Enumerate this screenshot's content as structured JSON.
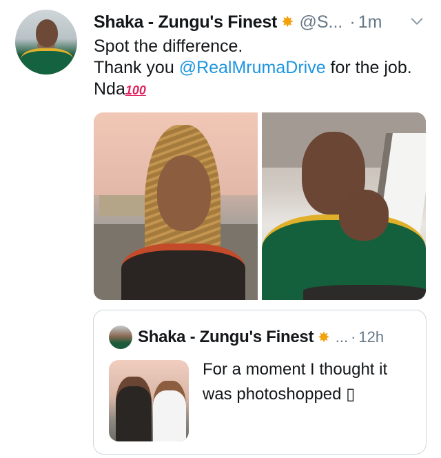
{
  "tweet": {
    "author_name": "Shaka - Zungu's Finest",
    "author_emoji": "✸",
    "handle": "@S...",
    "separator": "·",
    "time": "1m",
    "text_line1": "Spot the difference.",
    "text_line2_prefix": "Thank you ",
    "mention": "@RealMrumaDrive",
    "text_line2_suffix": " for the job.",
    "text_line3_prefix": "Nda",
    "hundred_emoji": "100"
  },
  "quoted_tweet": {
    "author_name": "Shaka - Zungu's Finest",
    "author_emoji": "✸",
    "more": "...",
    "separator": "·",
    "time": "12h",
    "text": "For a moment I thought it was photoshopped ▯"
  },
  "icons": {
    "menu": "chevron-down-icon",
    "emoji": "sparkle-emoji-icon",
    "hundred": "hundred-points-icon"
  },
  "colors": {
    "text": "#14171a",
    "secondary": "#657786",
    "link": "#1b95e0",
    "border": "#ccd6dd",
    "emoji": "#f2a20c"
  }
}
